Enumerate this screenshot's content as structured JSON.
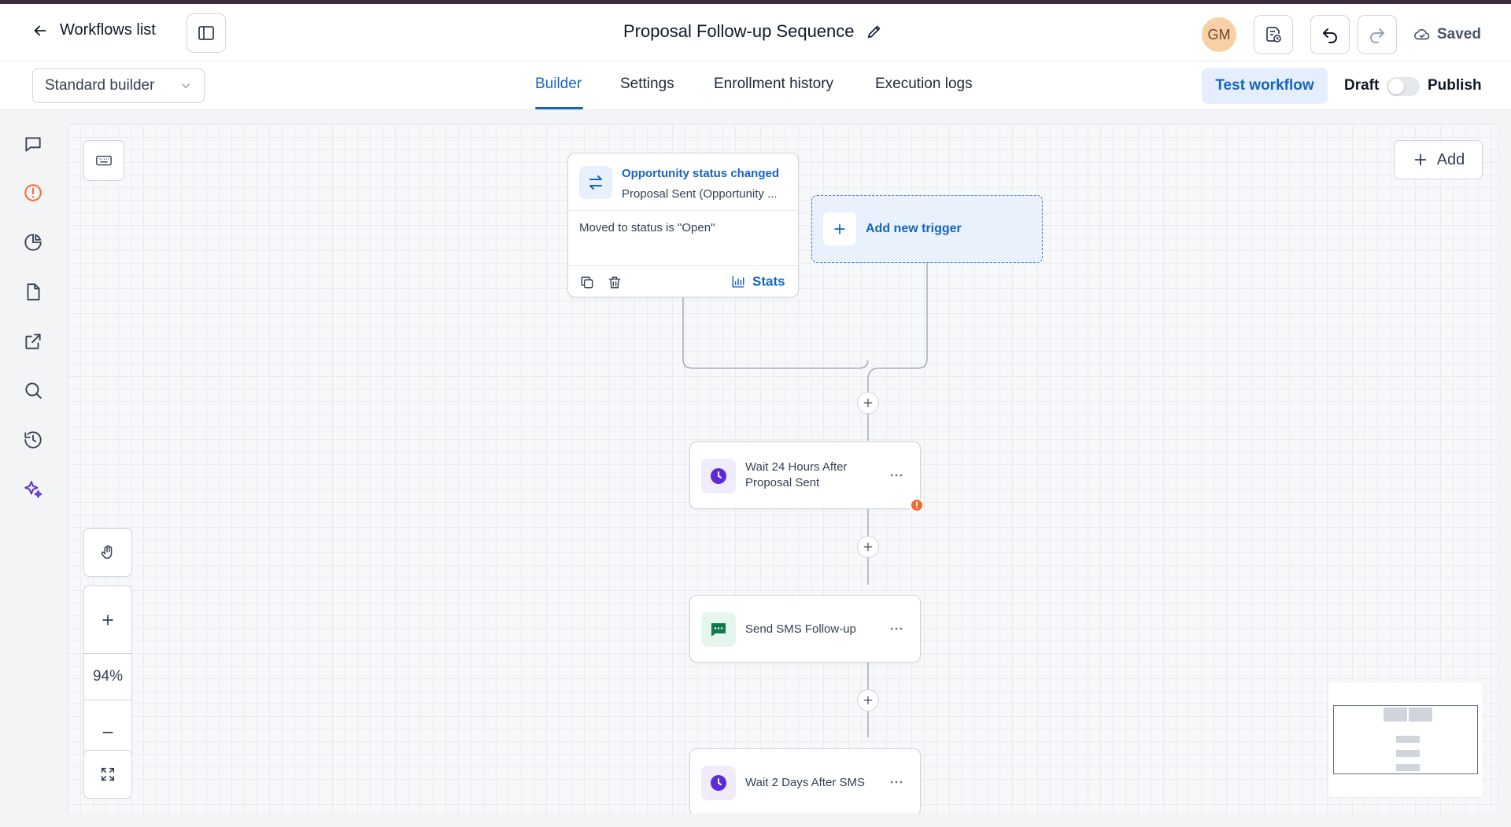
{
  "header": {
    "back_label": "Workflows list",
    "title": "Proposal Follow-up Sequence",
    "avatar_initials": "GM",
    "saved_label": "Saved"
  },
  "subheader": {
    "builder_select": "Standard builder",
    "tabs": [
      {
        "label": "Builder",
        "active": true
      },
      {
        "label": "Settings",
        "active": false
      },
      {
        "label": "Enrollment history",
        "active": false
      },
      {
        "label": "Execution logs",
        "active": false
      }
    ],
    "test_label": "Test workflow",
    "draft_label": "Draft",
    "publish_label": "Publish",
    "published": false
  },
  "rail": {
    "icons": [
      "chat-bubble-icon",
      "alert-circle-icon",
      "pie-chart-icon",
      "document-icon",
      "external-link-icon",
      "search-icon",
      "history-icon",
      "sparkles-icon"
    ]
  },
  "canvas": {
    "add_label": "Add",
    "zoom": "94%",
    "trigger": {
      "title": "Opportunity status changed",
      "subtitle": "Proposal Sent (Opportunity ...",
      "condition": "Moved to status is \"Open\"",
      "stats_label": "Stats"
    },
    "new_trigger_label": "Add new trigger",
    "actions": [
      {
        "line1": "Wait 24 Hours After",
        "line2": "Proposal Sent",
        "type": "wait",
        "warning": true
      },
      {
        "line1": "Send SMS Follow-up",
        "line2": "",
        "type": "sms",
        "warning": false
      },
      {
        "line1": "Wait 2 Days After SMS",
        "line2": "",
        "type": "wait",
        "warning": false
      }
    ],
    "warning_symbol": "!"
  },
  "colors": {
    "accent": "#1565c0",
    "wait_icon": "#5b2bd9",
    "sms_icon": "#0f7a4d",
    "warning": "#f26b30",
    "avatar_bg": "#f9cfa6"
  }
}
